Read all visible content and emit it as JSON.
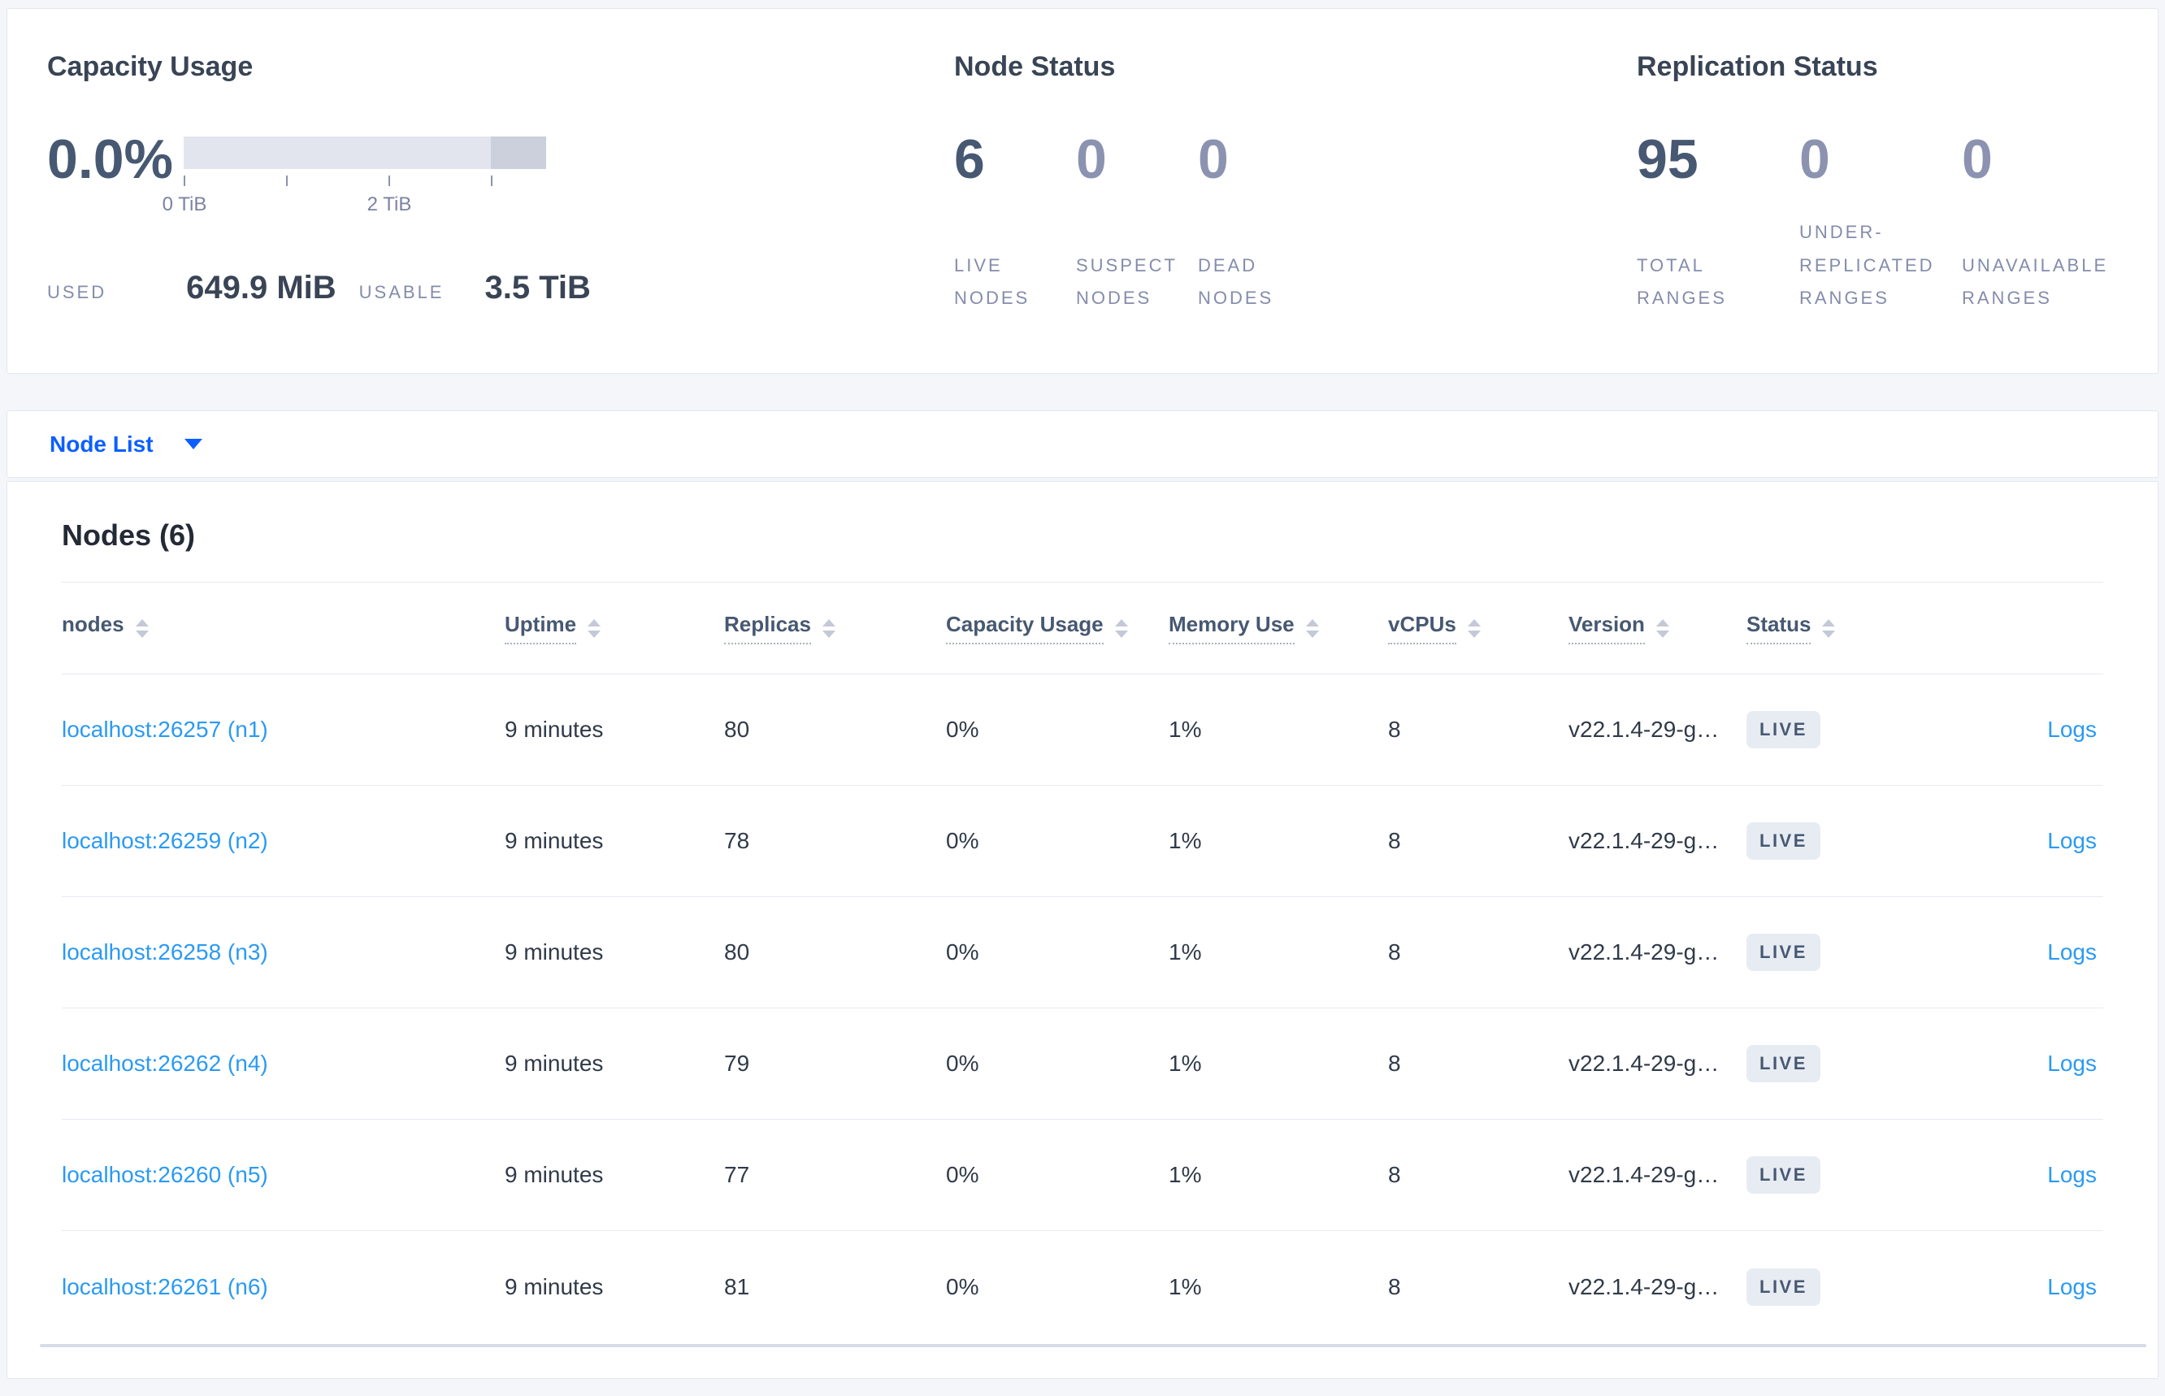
{
  "colors": {
    "accent_blue": "#0b5fff",
    "link_blue": "#2b9af3",
    "heading_dark": "#394455",
    "stat_emphasis": "#475872",
    "stat_muted": "#8b93b1",
    "bar_light": "#e2e5ee",
    "bar_dark": "#cbd0dc",
    "badge_bg": "#e7ecf3"
  },
  "summary": {
    "capacity": {
      "title": "Capacity Usage",
      "percent": "0.0%",
      "tick_labels": [
        "0 TiB",
        "2 TiB"
      ],
      "used_label": "USED",
      "used_value": "649.9 MiB",
      "usable_label": "USABLE",
      "usable_value": "3.5 TiB"
    },
    "node_status": {
      "title": "Node Status",
      "stats": [
        {
          "value": "6",
          "label": "LIVE NODES"
        },
        {
          "value": "0",
          "label": "SUSPECT NODES"
        },
        {
          "value": "0",
          "label": "DEAD NODES"
        }
      ]
    },
    "replication": {
      "title": "Replication Status",
      "stats": [
        {
          "value": "95",
          "label": "TOTAL RANGES"
        },
        {
          "value": "0",
          "label": "UNDER-REPLICATED RANGES"
        },
        {
          "value": "0",
          "label": "UNAVAILABLE RANGES"
        }
      ]
    }
  },
  "view_selector": {
    "label": "Node List"
  },
  "table": {
    "title": "Nodes (6)",
    "columns": [
      {
        "key": "nodes",
        "label": "nodes",
        "underlined": false
      },
      {
        "key": "uptime",
        "label": "Uptime",
        "underlined": true
      },
      {
        "key": "replicas",
        "label": "Replicas",
        "underlined": true
      },
      {
        "key": "capacity",
        "label": "Capacity Usage",
        "underlined": true
      },
      {
        "key": "memory",
        "label": "Memory Use",
        "underlined": true
      },
      {
        "key": "vcpus",
        "label": "vCPUs",
        "underlined": true
      },
      {
        "key": "version",
        "label": "Version",
        "underlined": true
      },
      {
        "key": "status",
        "label": "Status",
        "underlined": true
      },
      {
        "key": "logs",
        "label": "",
        "underlined": false
      }
    ],
    "rows": [
      {
        "node": "localhost:26257 (n1)",
        "uptime": "9 minutes",
        "replicas": "80",
        "capacity": "0%",
        "memory": "1%",
        "vcpus": "8",
        "version": "v22.1.4-29-g…",
        "status": "LIVE",
        "logs": "Logs"
      },
      {
        "node": "localhost:26259 (n2)",
        "uptime": "9 minutes",
        "replicas": "78",
        "capacity": "0%",
        "memory": "1%",
        "vcpus": "8",
        "version": "v22.1.4-29-g…",
        "status": "LIVE",
        "logs": "Logs"
      },
      {
        "node": "localhost:26258 (n3)",
        "uptime": "9 minutes",
        "replicas": "80",
        "capacity": "0%",
        "memory": "1%",
        "vcpus": "8",
        "version": "v22.1.4-29-g…",
        "status": "LIVE",
        "logs": "Logs"
      },
      {
        "node": "localhost:26262 (n4)",
        "uptime": "9 minutes",
        "replicas": "79",
        "capacity": "0%",
        "memory": "1%",
        "vcpus": "8",
        "version": "v22.1.4-29-g…",
        "status": "LIVE",
        "logs": "Logs"
      },
      {
        "node": "localhost:26260 (n5)",
        "uptime": "9 minutes",
        "replicas": "77",
        "capacity": "0%",
        "memory": "1%",
        "vcpus": "8",
        "version": "v22.1.4-29-g…",
        "status": "LIVE",
        "logs": "Logs"
      },
      {
        "node": "localhost:26261 (n6)",
        "uptime": "9 minutes",
        "replicas": "81",
        "capacity": "0%",
        "memory": "1%",
        "vcpus": "8",
        "version": "v22.1.4-29-g…",
        "status": "LIVE",
        "logs": "Logs"
      }
    ]
  }
}
